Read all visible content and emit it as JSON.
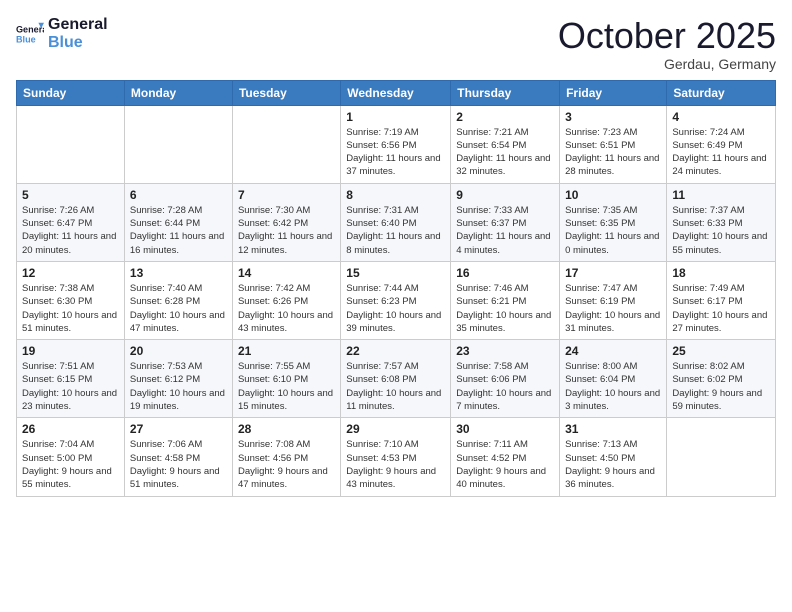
{
  "header": {
    "logo_line1": "General",
    "logo_line2": "Blue",
    "month_title": "October 2025",
    "location": "Gerdau, Germany"
  },
  "weekdays": [
    "Sunday",
    "Monday",
    "Tuesday",
    "Wednesday",
    "Thursday",
    "Friday",
    "Saturday"
  ],
  "weeks": [
    [
      {
        "day": "",
        "info": ""
      },
      {
        "day": "",
        "info": ""
      },
      {
        "day": "",
        "info": ""
      },
      {
        "day": "1",
        "info": "Sunrise: 7:19 AM\nSunset: 6:56 PM\nDaylight: 11 hours and 37 minutes."
      },
      {
        "day": "2",
        "info": "Sunrise: 7:21 AM\nSunset: 6:54 PM\nDaylight: 11 hours and 32 minutes."
      },
      {
        "day": "3",
        "info": "Sunrise: 7:23 AM\nSunset: 6:51 PM\nDaylight: 11 hours and 28 minutes."
      },
      {
        "day": "4",
        "info": "Sunrise: 7:24 AM\nSunset: 6:49 PM\nDaylight: 11 hours and 24 minutes."
      }
    ],
    [
      {
        "day": "5",
        "info": "Sunrise: 7:26 AM\nSunset: 6:47 PM\nDaylight: 11 hours and 20 minutes."
      },
      {
        "day": "6",
        "info": "Sunrise: 7:28 AM\nSunset: 6:44 PM\nDaylight: 11 hours and 16 minutes."
      },
      {
        "day": "7",
        "info": "Sunrise: 7:30 AM\nSunset: 6:42 PM\nDaylight: 11 hours and 12 minutes."
      },
      {
        "day": "8",
        "info": "Sunrise: 7:31 AM\nSunset: 6:40 PM\nDaylight: 11 hours and 8 minutes."
      },
      {
        "day": "9",
        "info": "Sunrise: 7:33 AM\nSunset: 6:37 PM\nDaylight: 11 hours and 4 minutes."
      },
      {
        "day": "10",
        "info": "Sunrise: 7:35 AM\nSunset: 6:35 PM\nDaylight: 11 hours and 0 minutes."
      },
      {
        "day": "11",
        "info": "Sunrise: 7:37 AM\nSunset: 6:33 PM\nDaylight: 10 hours and 55 minutes."
      }
    ],
    [
      {
        "day": "12",
        "info": "Sunrise: 7:38 AM\nSunset: 6:30 PM\nDaylight: 10 hours and 51 minutes."
      },
      {
        "day": "13",
        "info": "Sunrise: 7:40 AM\nSunset: 6:28 PM\nDaylight: 10 hours and 47 minutes."
      },
      {
        "day": "14",
        "info": "Sunrise: 7:42 AM\nSunset: 6:26 PM\nDaylight: 10 hours and 43 minutes."
      },
      {
        "day": "15",
        "info": "Sunrise: 7:44 AM\nSunset: 6:23 PM\nDaylight: 10 hours and 39 minutes."
      },
      {
        "day": "16",
        "info": "Sunrise: 7:46 AM\nSunset: 6:21 PM\nDaylight: 10 hours and 35 minutes."
      },
      {
        "day": "17",
        "info": "Sunrise: 7:47 AM\nSunset: 6:19 PM\nDaylight: 10 hours and 31 minutes."
      },
      {
        "day": "18",
        "info": "Sunrise: 7:49 AM\nSunset: 6:17 PM\nDaylight: 10 hours and 27 minutes."
      }
    ],
    [
      {
        "day": "19",
        "info": "Sunrise: 7:51 AM\nSunset: 6:15 PM\nDaylight: 10 hours and 23 minutes."
      },
      {
        "day": "20",
        "info": "Sunrise: 7:53 AM\nSunset: 6:12 PM\nDaylight: 10 hours and 19 minutes."
      },
      {
        "day": "21",
        "info": "Sunrise: 7:55 AM\nSunset: 6:10 PM\nDaylight: 10 hours and 15 minutes."
      },
      {
        "day": "22",
        "info": "Sunrise: 7:57 AM\nSunset: 6:08 PM\nDaylight: 10 hours and 11 minutes."
      },
      {
        "day": "23",
        "info": "Sunrise: 7:58 AM\nSunset: 6:06 PM\nDaylight: 10 hours and 7 minutes."
      },
      {
        "day": "24",
        "info": "Sunrise: 8:00 AM\nSunset: 6:04 PM\nDaylight: 10 hours and 3 minutes."
      },
      {
        "day": "25",
        "info": "Sunrise: 8:02 AM\nSunset: 6:02 PM\nDaylight: 9 hours and 59 minutes."
      }
    ],
    [
      {
        "day": "26",
        "info": "Sunrise: 7:04 AM\nSunset: 5:00 PM\nDaylight: 9 hours and 55 minutes."
      },
      {
        "day": "27",
        "info": "Sunrise: 7:06 AM\nSunset: 4:58 PM\nDaylight: 9 hours and 51 minutes."
      },
      {
        "day": "28",
        "info": "Sunrise: 7:08 AM\nSunset: 4:56 PM\nDaylight: 9 hours and 47 minutes."
      },
      {
        "day": "29",
        "info": "Sunrise: 7:10 AM\nSunset: 4:53 PM\nDaylight: 9 hours and 43 minutes."
      },
      {
        "day": "30",
        "info": "Sunrise: 7:11 AM\nSunset: 4:52 PM\nDaylight: 9 hours and 40 minutes."
      },
      {
        "day": "31",
        "info": "Sunrise: 7:13 AM\nSunset: 4:50 PM\nDaylight: 9 hours and 36 minutes."
      },
      {
        "day": "",
        "info": ""
      }
    ]
  ]
}
